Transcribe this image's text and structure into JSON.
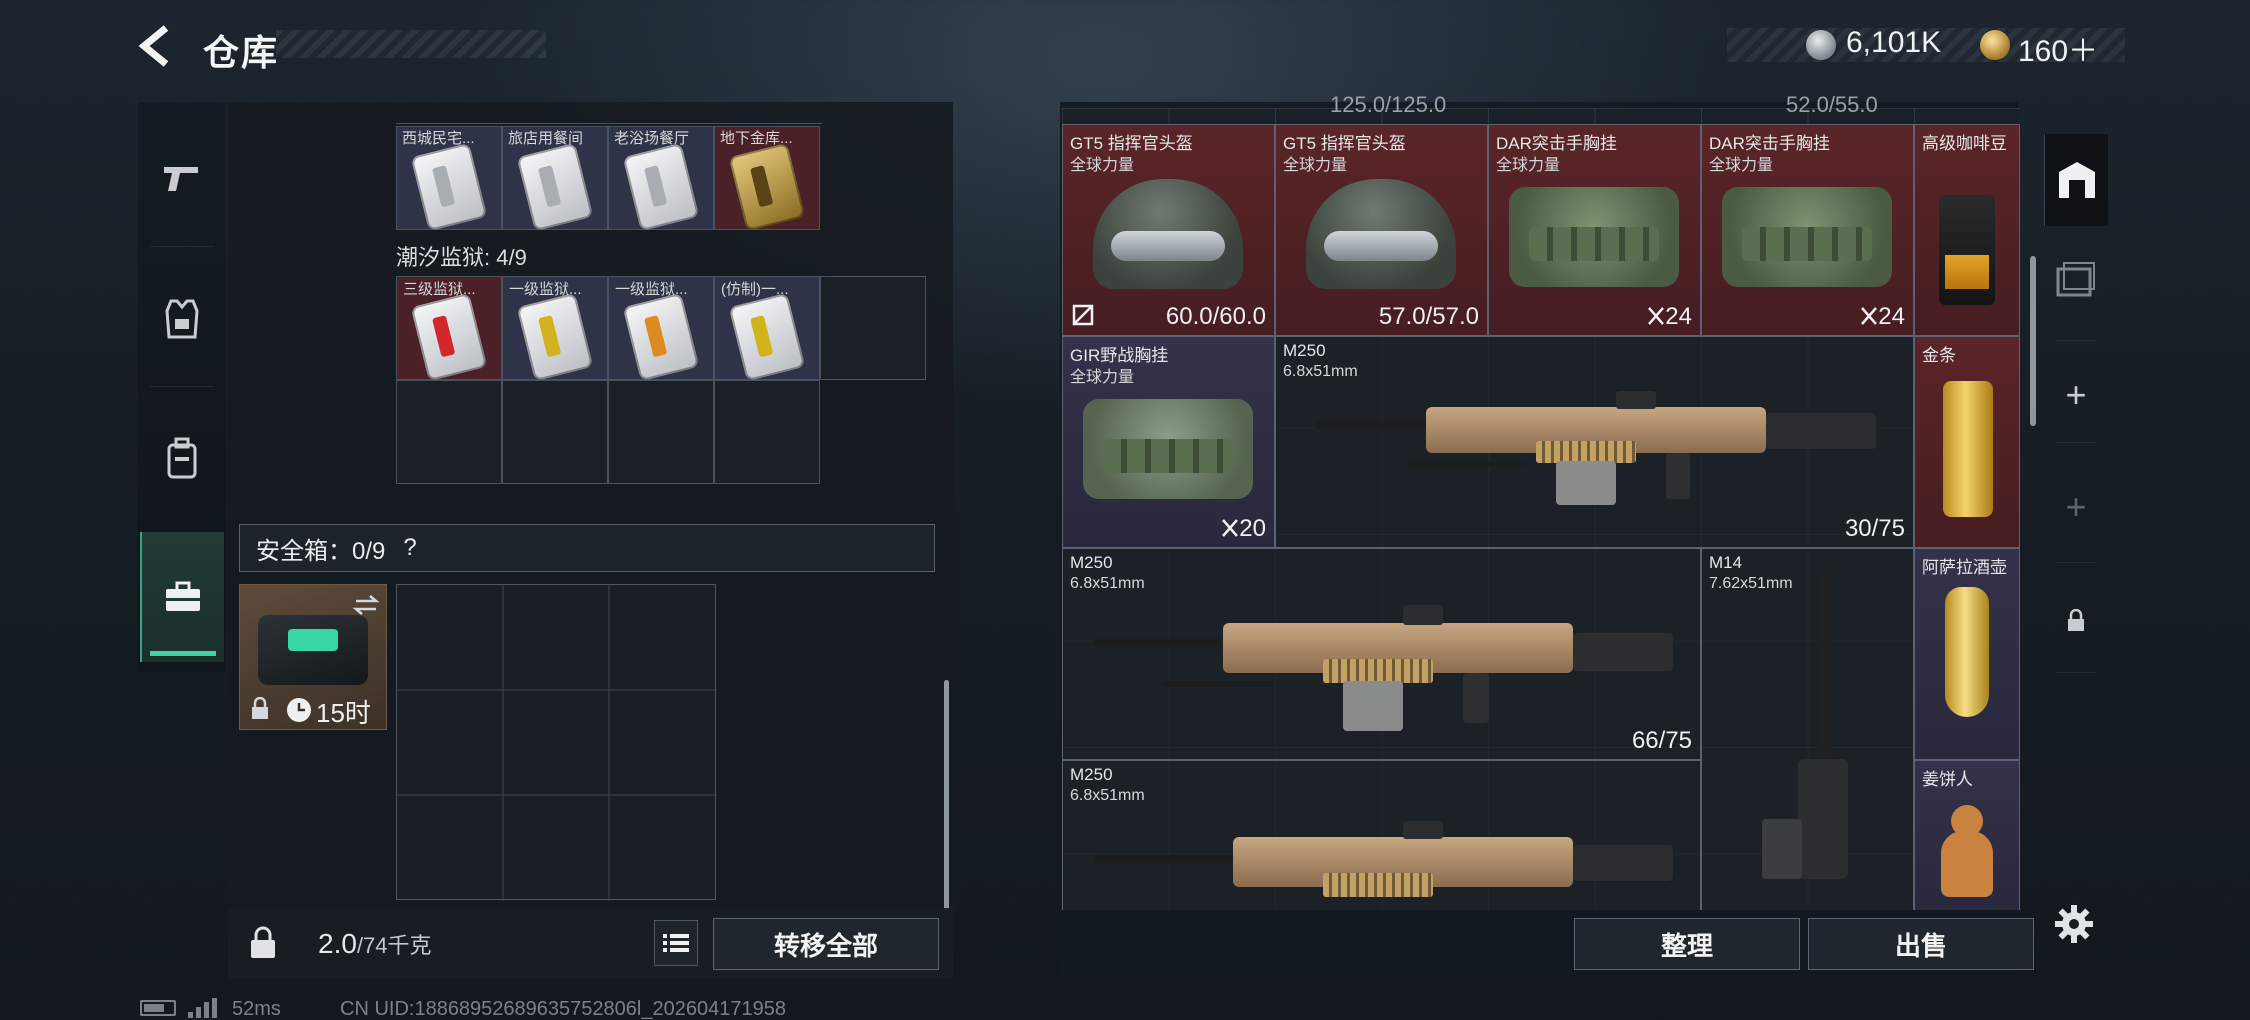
{
  "header": {
    "title": "仓库",
    "currency": [
      {
        "icon": "silver-coin-icon",
        "value": "6,101K"
      },
      {
        "icon": "gold-coin-icon",
        "value": "160＋"
      }
    ],
    "currency_plus": "+"
  },
  "left_nav": {
    "tabs": [
      {
        "icon": "pistol-icon"
      },
      {
        "icon": "armor-vest-icon"
      },
      {
        "icon": "backpack-icon"
      },
      {
        "icon": "briefcase-icon",
        "active": true
      }
    ]
  },
  "keys": {
    "row1": [
      {
        "label": "西城民宅...",
        "color": "blue",
        "strip": "silver"
      },
      {
        "label": "旅店用餐间",
        "color": "blue",
        "strip": "silver"
      },
      {
        "label": "老浴场餐厅",
        "color": "blue",
        "strip": "silver"
      },
      {
        "label": "地下金库...",
        "color": "red",
        "strip": "gold"
      }
    ],
    "section2_title": "潮汐监狱: 4/9",
    "row2": [
      {
        "label": "三级监狱...",
        "color": "red",
        "strip": "red"
      },
      {
        "label": "一级监狱...",
        "color": "blue",
        "strip": "yellow"
      },
      {
        "label": "一级监狱...",
        "color": "blue",
        "strip": "orange"
      },
      {
        "label": "(仿制)一...",
        "color": "blue",
        "strip": "yellow"
      }
    ]
  },
  "safebox": {
    "header": "安全箱：0/9",
    "help": "?",
    "timer": "15时"
  },
  "bottom_left": {
    "weight_value": "2.0",
    "weight_cap": "/74千克",
    "transfer_all": "转移全部"
  },
  "right_panel": {
    "partial_values": [
      "125.0/125.0",
      "52.0/55.0"
    ],
    "items": [
      {
        "name": "GT5 指挥官头盔",
        "sub": "全球力量",
        "value": "60.0/60.0",
        "broken": true
      },
      {
        "name": "GT5 指挥官头盔",
        "sub": "全球力量",
        "value": "57.0/57.0"
      },
      {
        "name": "DAR突击手胸挂",
        "sub": "全球力量",
        "stack": "24"
      },
      {
        "name": "DAR突击手胸挂",
        "sub": "全球力量",
        "stack": "24"
      },
      {
        "name": "高级咖啡豆"
      },
      {
        "name": "GIR野战胸挂",
        "sub": "全球力量",
        "stack": "20"
      },
      {
        "name": "M250",
        "sub": "6.8x51mm",
        "value": "30/75"
      },
      {
        "name": "金条"
      },
      {
        "name": "M250",
        "sub": "6.8x51mm",
        "value": "66/75"
      },
      {
        "name": "M14",
        "sub": "7.62x51mm"
      },
      {
        "name": "阿萨拉酒壶"
      },
      {
        "name": "M250",
        "sub": "6.8x51mm"
      },
      {
        "name": "姜饼人"
      }
    ]
  },
  "bottom_right": {
    "sort": "整理",
    "sell": "出售"
  },
  "right_rail": {
    "plus1": "+",
    "plus2": "+"
  },
  "status_bar": {
    "ping": "52ms",
    "uid": "CN UID:18868952689635752806l_202604171958"
  }
}
